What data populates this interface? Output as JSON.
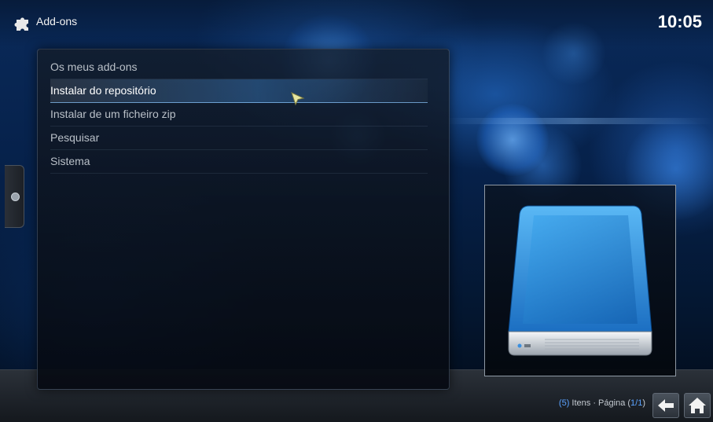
{
  "header": {
    "icon": "puzzle-piece-icon",
    "title": "Add-ons",
    "clock": "10:05"
  },
  "menu": {
    "items": [
      {
        "label": "Os meus add-ons",
        "selected": false
      },
      {
        "label": "Instalar do repositório",
        "selected": true
      },
      {
        "label": "Instalar de um ficheiro zip",
        "selected": false
      },
      {
        "label": "Pesquisar",
        "selected": false
      },
      {
        "label": "Sistema",
        "selected": false
      }
    ]
  },
  "side_tab": {
    "icon": "circle-icon"
  },
  "thumbnail": {
    "icon": "hard-drive-icon"
  },
  "footer": {
    "count_open": "(",
    "count": "5",
    "count_close": ")",
    "items_text": " Itens · Página (",
    "page": "1/1",
    "page_close": ")",
    "back_icon": "back-arrow-icon",
    "home_icon": "home-icon"
  },
  "colors": {
    "accent": "#5aa2ff",
    "text": "#b9c0c8",
    "selected_text": "#ffffff",
    "background": "#06214a"
  }
}
